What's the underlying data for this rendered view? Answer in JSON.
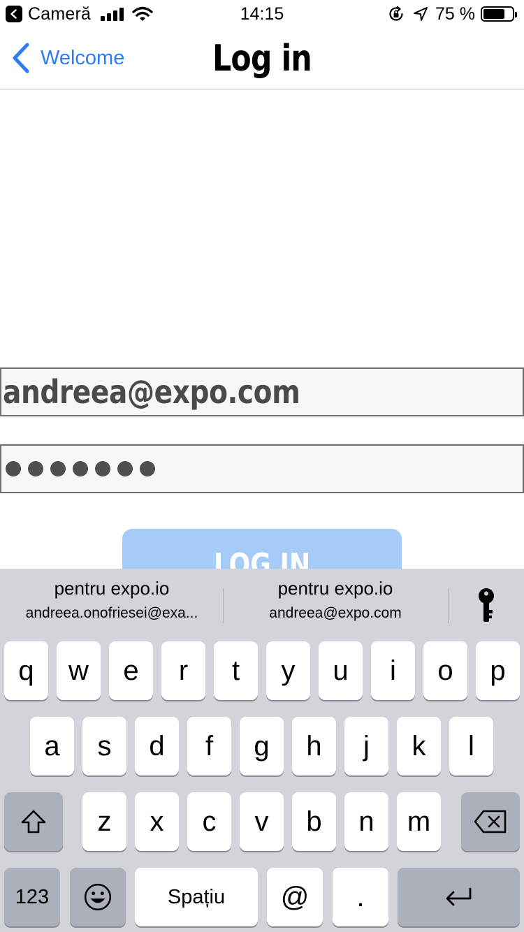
{
  "status_bar": {
    "back_app": "Cameră",
    "time": "14:15",
    "battery_percent": "75 %",
    "battery_level": 0.75,
    "icons": [
      "back-app-icon",
      "signal-icon",
      "wifi-icon",
      "rotation-lock-icon",
      "location-icon",
      "battery-icon"
    ]
  },
  "nav": {
    "back_label": "Welcome",
    "title": "Log in"
  },
  "form": {
    "email_value": "andreea@expo.com",
    "password_dot_count": 7,
    "login_button": "LOG IN"
  },
  "keyboard": {
    "suggestions": [
      {
        "title": "pentru expo.io",
        "subtitle": "andreea.onofriesei@exa..."
      },
      {
        "title": "pentru expo.io",
        "subtitle": "andreea@expo.com"
      }
    ],
    "row1": [
      "q",
      "w",
      "e",
      "r",
      "t",
      "y",
      "u",
      "i",
      "o",
      "p"
    ],
    "row2": [
      "a",
      "s",
      "d",
      "f",
      "g",
      "h",
      "j",
      "k",
      "l"
    ],
    "row3": [
      "z",
      "x",
      "c",
      "v",
      "b",
      "n",
      "m"
    ],
    "numbers_key": "123",
    "space_key": "Spațiu",
    "at_key": "@",
    "dot_key": ".",
    "colors": {
      "background": "#d2d4da",
      "key": "#ffffff",
      "dark_key": "#abb0bb"
    }
  },
  "colors": {
    "accent": "#2d7cf6",
    "button": "#a6cbf9",
    "field_border": "#6e6e6e"
  }
}
